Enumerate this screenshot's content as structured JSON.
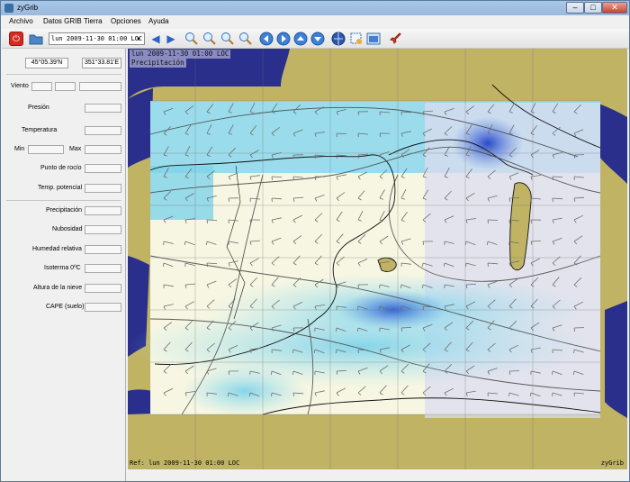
{
  "window": {
    "title": "zyGrib"
  },
  "menu": [
    "Archivo",
    "Datos GRIB",
    "Tierra",
    "Opciones",
    "Ayuda"
  ],
  "toolbar": {
    "date_value": "lun 2009-11-30 01:00 LOC"
  },
  "sidebar": {
    "lat": "45°05.39'N",
    "lon": "351°33.81'E",
    "labels": {
      "viento": "Viento",
      "presion": "Presión",
      "temperatura": "Temperatura",
      "min": "Min",
      "max": "Max",
      "punto_rocio": "Punto de rocío",
      "temp_potencial": "Temp. potencial",
      "precipitacion": "Precipitación",
      "nubosidad": "Nubosidad",
      "humedad": "Humedad relativa",
      "isoterma": "Isoterma 0ºC",
      "altura_nieve": "Altura de la nieve",
      "cape": "CAPE (suelo)"
    }
  },
  "map": {
    "date_label": "lun 2009-11-30 01:00 LOC",
    "layer_label": "Precipitación",
    "ref_label": "Ref: lun 2009-11-30 01:00 LOC",
    "brand": "zyGrib"
  },
  "colors": {
    "sea": "#2a2f8c",
    "land": "#c0b364",
    "precip_light": "#f6f6e2",
    "precip_mid": "#7fd3ea",
    "precip_strong": "#3a72d8",
    "titlebar": "#a9c6e6"
  }
}
